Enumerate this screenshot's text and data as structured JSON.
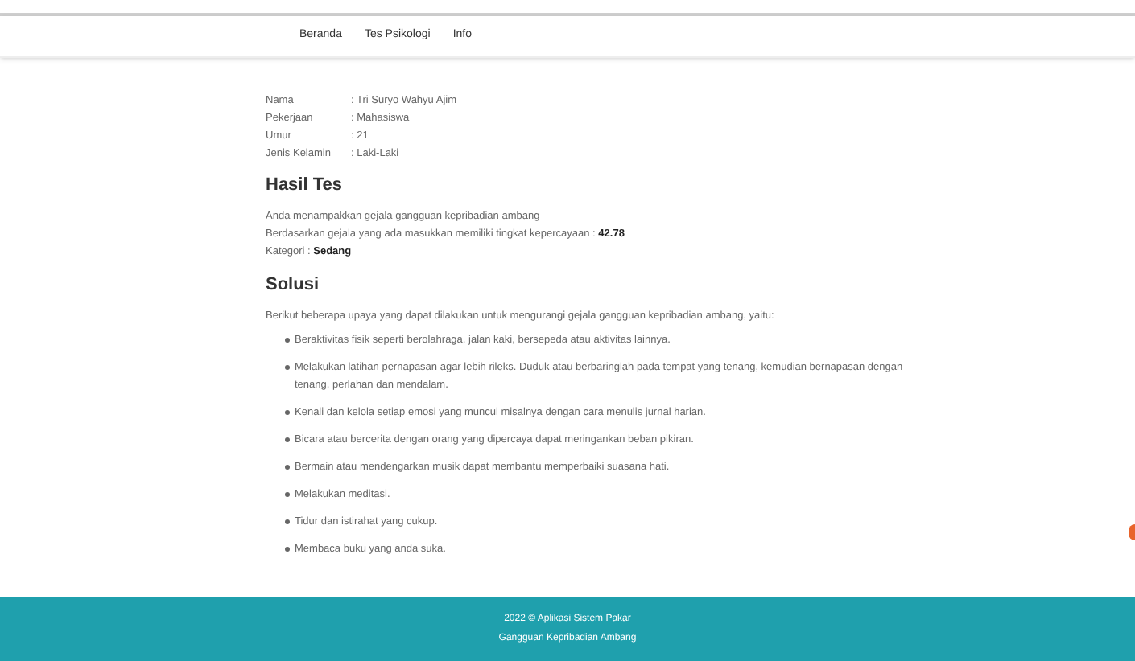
{
  "nav": [
    {
      "label": "Beranda"
    },
    {
      "label": "Tes Psikologi"
    },
    {
      "label": "Info"
    }
  ],
  "profile": [
    {
      "label": "Nama",
      "value": ": Tri Suryo Wahyu Ajim"
    },
    {
      "label": "Pekerjaan",
      "value": ": Mahasiswa"
    },
    {
      "label": "Umur",
      "value": ": 21"
    },
    {
      "label": "Jenis Kelamin",
      "value": ": Laki-Laki"
    }
  ],
  "result": {
    "title": "Hasil Tes",
    "lines": [
      "Anda menampakkan gejala gangguan kepribadian ambang",
      "Berdasarkan gejala yang ada masukkan memiliki tingkat kepercayaan : **42.78**",
      "Kategori : **Sedang**"
    ]
  },
  "solution": {
    "title": "Solusi",
    "intro": "Berikut beberapa upaya yang dapat dilakukan untuk mengurangi gejala gangguan kepribadian ambang, yaitu:",
    "items": [
      "Beraktivitas fisik seperti berolahraga, jalan kaki, bersepeda atau aktivitas lainnya.",
      "Melakukan latihan pernapasan agar lebih rileks. Duduk atau berbaringlah pada tempat yang tenang, kemudian bernapasan dengan tenang, perlahan dan mendalam.",
      "Kenali dan kelola setiap emosi yang muncul misalnya dengan cara menulis jurnal harian.",
      "Bicara atau bercerita dengan orang yang dipercaya dapat meringankan beban pikiran.",
      "Bermain atau mendengarkan musik dapat membantu memperbaiki suasana hati.",
      "Melakukan meditasi.",
      "Tidur dan istirahat yang cukup.",
      "Membaca buku yang anda suka."
    ]
  },
  "footer": [
    "2022 © Aplikasi Sistem Pakar",
    "Gangguan Kepribadian Ambang"
  ]
}
